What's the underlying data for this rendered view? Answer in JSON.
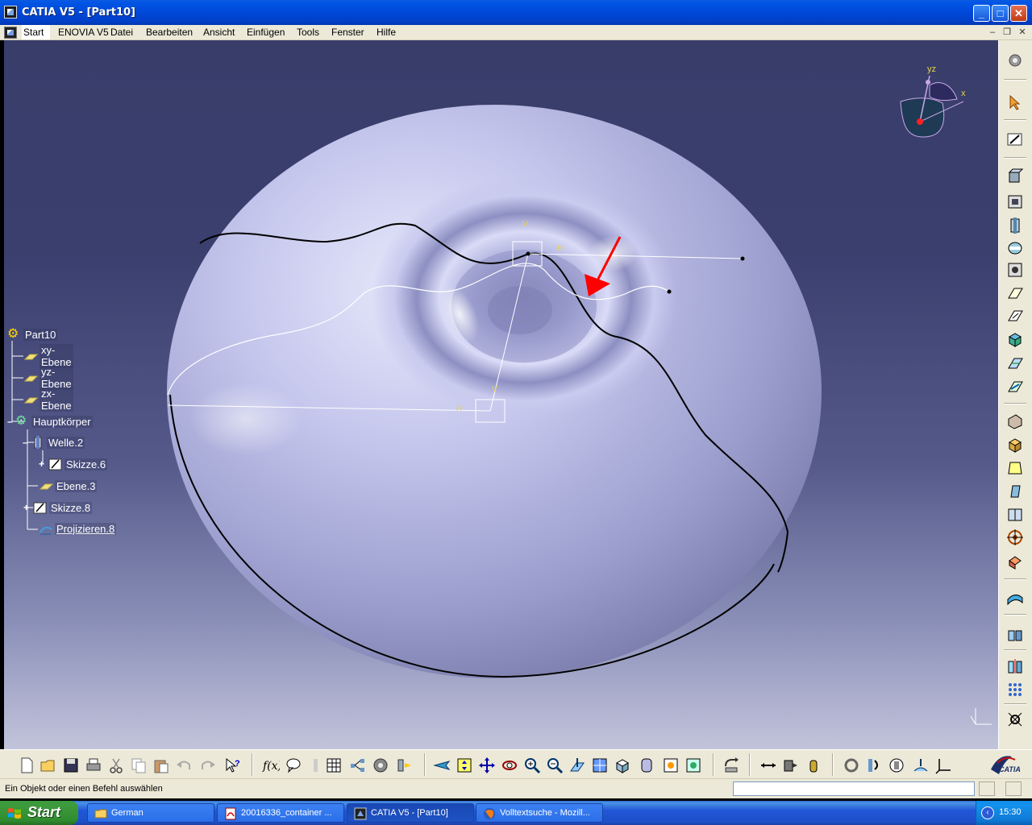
{
  "window": {
    "title": "CATIA V5 - [Part10]",
    "minimize_label": "_",
    "maximize_label": "□",
    "close_label": "✕"
  },
  "menu": {
    "items": [
      {
        "label": "Start"
      },
      {
        "label": "ENOVIA V5"
      },
      {
        "label": "Datei"
      },
      {
        "label": "Bearbeiten"
      },
      {
        "label": "Ansicht"
      },
      {
        "label": "Einfügen"
      },
      {
        "label": "Tools"
      },
      {
        "label": "Fenster"
      },
      {
        "label": "Hilfe"
      }
    ],
    "mdi_min": "–",
    "mdi_restore": "❐",
    "mdi_close": "✕"
  },
  "tree": {
    "root": "Part10",
    "items": [
      {
        "label": "xy-Ebene"
      },
      {
        "label": "yz-Ebene"
      },
      {
        "label": "zx-Ebene"
      },
      {
        "label": "Hauptkörper"
      },
      {
        "label": "Welle.2"
      },
      {
        "label": "Skizze.6"
      },
      {
        "label": "Ebene.3"
      },
      {
        "label": "Skizze.8"
      },
      {
        "label": "Projizieren.8"
      }
    ]
  },
  "compass": {
    "x_label": "x",
    "yz_label": "yz"
  },
  "axis_labels": {
    "v": "V",
    "h": "H"
  },
  "status": {
    "prompt": "Ein Objekt oder einen Befehl auswählen"
  },
  "taskbar": {
    "start_label": "Start",
    "tasks": [
      {
        "label": "German"
      },
      {
        "label": "20016336_container ..."
      },
      {
        "label": "CATIA V5 - [Part10]"
      },
      {
        "label": "Volltextsuche - Mozill..."
      }
    ],
    "clock": "15:30"
  },
  "brand": {
    "logo_text": "CATIA"
  },
  "colors": {
    "viewport_top": "#393d6a",
    "surface": "#b9bbe2",
    "accent_red": "#ff0000"
  }
}
